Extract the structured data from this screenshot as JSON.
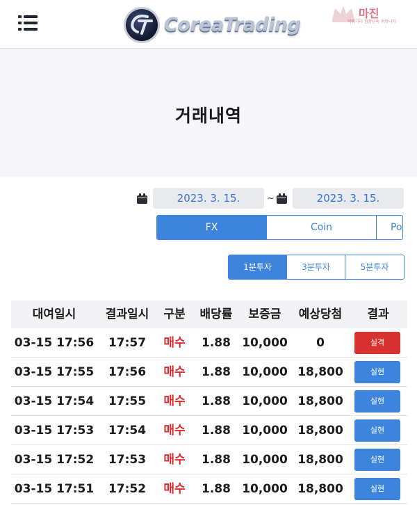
{
  "header": {
    "logo_text": "CoreaTrading",
    "watermark_title": "마진",
    "watermark_sub": "먹튀기리 집중단속 커뮤니티"
  },
  "page": {
    "title": "거래내역"
  },
  "date_range": {
    "start": "2023. 3. 15.",
    "separator": "~",
    "end": "2023. 3. 15."
  },
  "market_tabs": [
    {
      "label": "FX",
      "active": true
    },
    {
      "label": "Coin",
      "active": false
    },
    {
      "label": "Pov",
      "active": false
    }
  ],
  "interval_tabs": [
    {
      "label": "1분투자",
      "active": true
    },
    {
      "label": "3분투자",
      "active": false
    },
    {
      "label": "5분투자",
      "active": false
    }
  ],
  "table": {
    "headers": [
      "대여일시",
      "결과일시",
      "구분",
      "배당률",
      "보증금",
      "예상당첨",
      "결과"
    ],
    "rows": [
      {
        "open": "03-15 17:56",
        "close": "17:57",
        "side": "매수",
        "odds": "1.88",
        "deposit": "10,000",
        "expected": "0",
        "result": "실격",
        "result_type": "lose"
      },
      {
        "open": "03-15 17:55",
        "close": "17:56",
        "side": "매수",
        "odds": "1.88",
        "deposit": "10,000",
        "expected": "18,800",
        "result": "실현",
        "result_type": "win"
      },
      {
        "open": "03-15 17:54",
        "close": "17:55",
        "side": "매수",
        "odds": "1.88",
        "deposit": "10,000",
        "expected": "18,800",
        "result": "실현",
        "result_type": "win"
      },
      {
        "open": "03-15 17:53",
        "close": "17:54",
        "side": "매수",
        "odds": "1.88",
        "deposit": "10,000",
        "expected": "18,800",
        "result": "실현",
        "result_type": "win"
      },
      {
        "open": "03-15 17:52",
        "close": "17:53",
        "side": "매수",
        "odds": "1.88",
        "deposit": "10,000",
        "expected": "18,800",
        "result": "실현",
        "result_type": "win"
      },
      {
        "open": "03-15 17:51",
        "close": "17:52",
        "side": "매수",
        "odds": "1.88",
        "deposit": "10,000",
        "expected": "18,800",
        "result": "실현",
        "result_type": "win"
      }
    ]
  },
  "colors": {
    "accent": "#3c84dc",
    "buy_red": "#e0292d",
    "lose_red": "#d8312f",
    "title_band": "#f6f6fa"
  },
  "icons": {
    "menu": "hamburger-menu-icon",
    "calendar": "calendar-icon"
  }
}
